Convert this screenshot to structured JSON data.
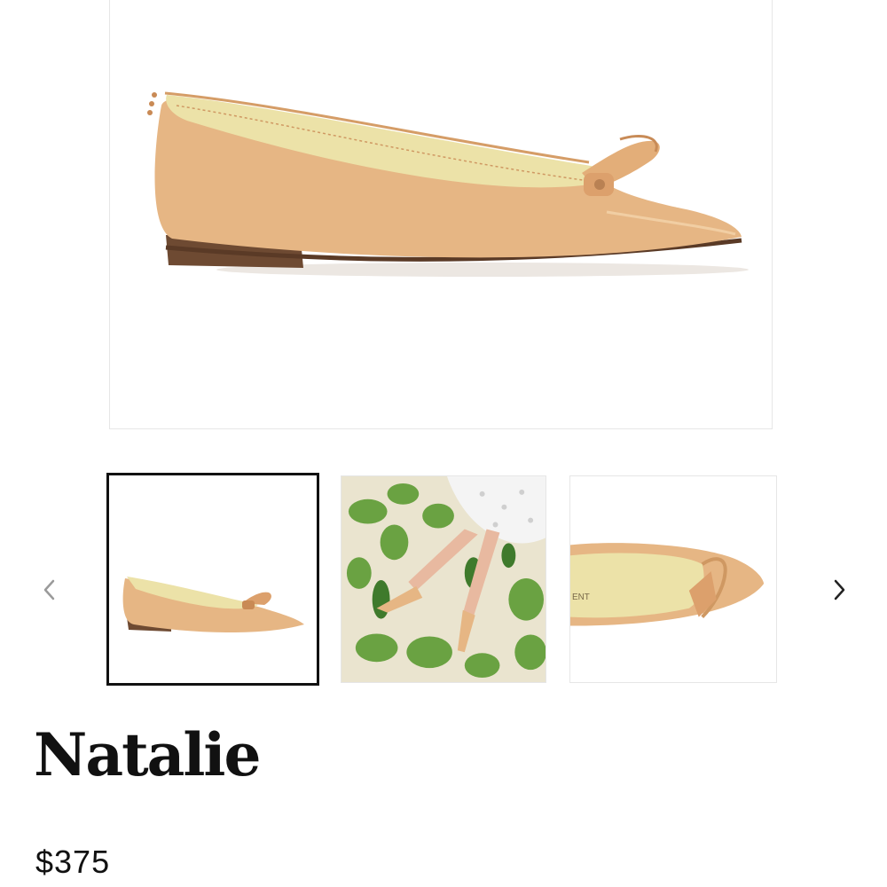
{
  "gallery": {
    "main_image": {
      "icon": "shoe-side-view-image",
      "upper_color": "#e6b684",
      "lining_color": "#ece2a8",
      "sole_color": "#6e4a32"
    },
    "thumbnails": [
      {
        "icon": "shoe-side-view-thumbnail",
        "selected": true
      },
      {
        "icon": "fern-lifestyle-thumbnail",
        "selected": false
      },
      {
        "icon": "shoe-toe-closeup-thumbnail",
        "selected": false
      }
    ],
    "prev_icon": "chevron-left-icon",
    "next_icon": "chevron-right-icon",
    "prev_color": "#9a9a9a",
    "next_color": "#222222"
  },
  "product": {
    "name": "Natalie",
    "price": "$375"
  }
}
